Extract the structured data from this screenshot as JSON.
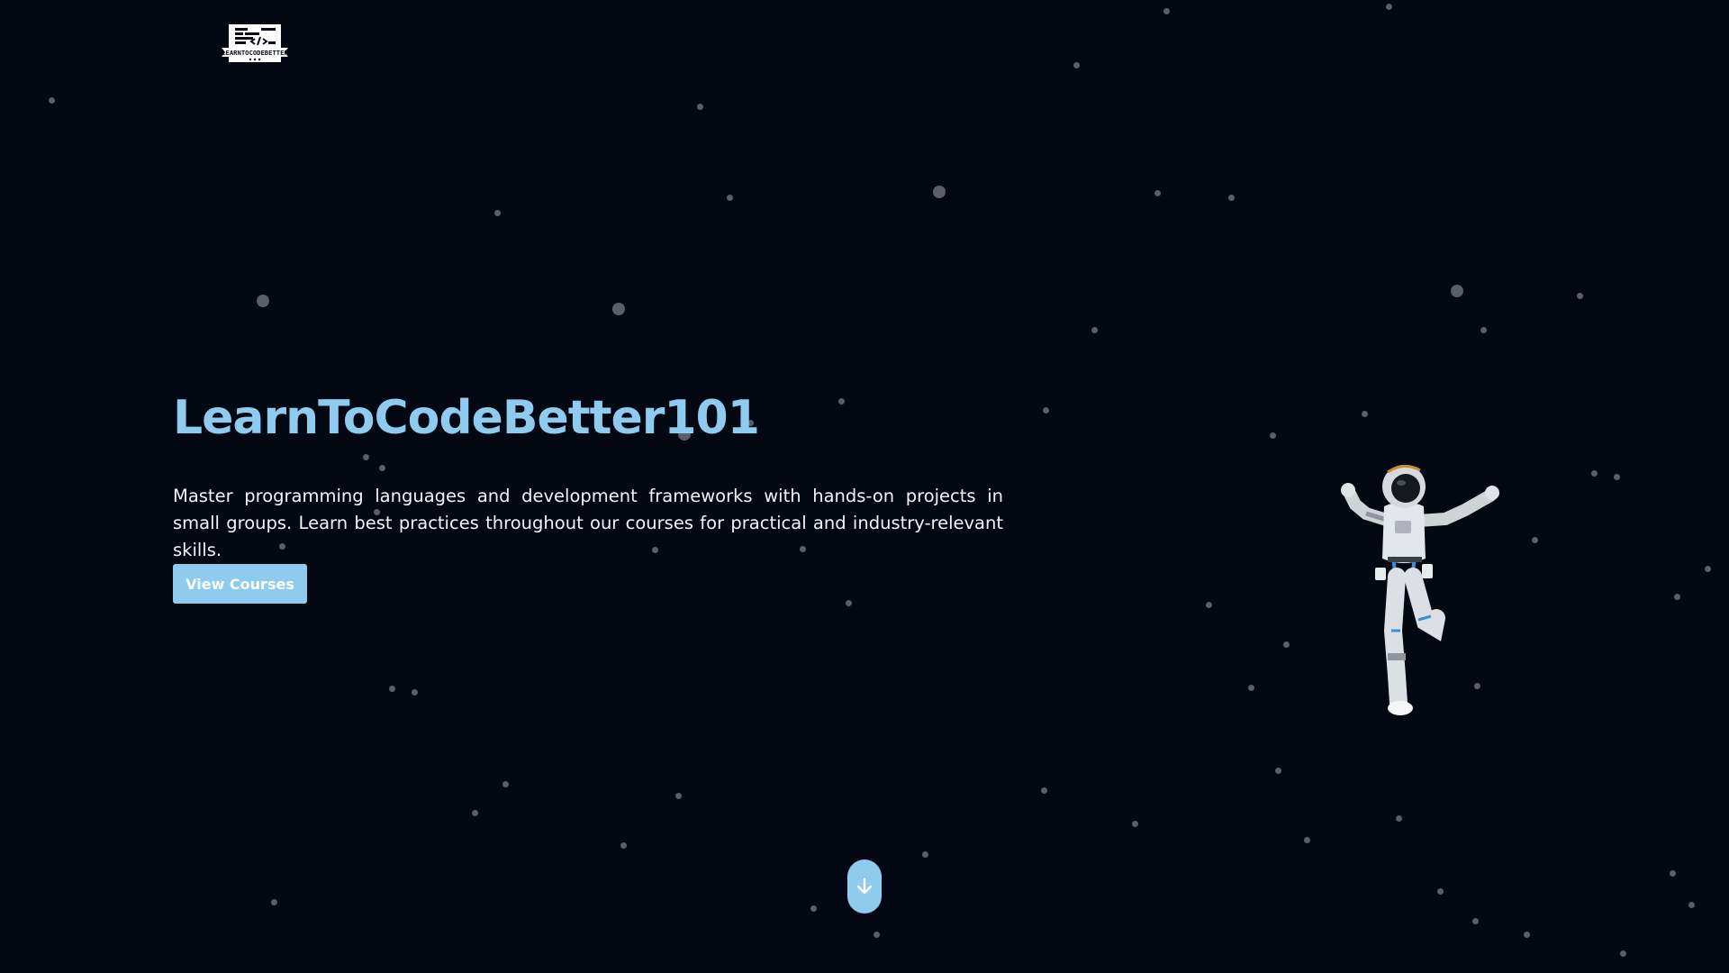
{
  "logo": {
    "text": "LEARNTOCODEBETTER",
    "icon": "code-logo-icon"
  },
  "hero": {
    "title": "LearnToCodeBetter101",
    "description": "Master programming languages and development frameworks with hands-on projects in small groups. Learn best practices throughout our courses for practical and industry-relevant skills.",
    "cta_label": "View Courses"
  },
  "illustration": {
    "icon": "astronaut-icon"
  },
  "scroll": {
    "icon": "arrow-down-icon"
  },
  "colors": {
    "background": "#030812",
    "accent": "#8ecbef",
    "text": "#f2f4f7",
    "star": "#5a5e66"
  }
}
